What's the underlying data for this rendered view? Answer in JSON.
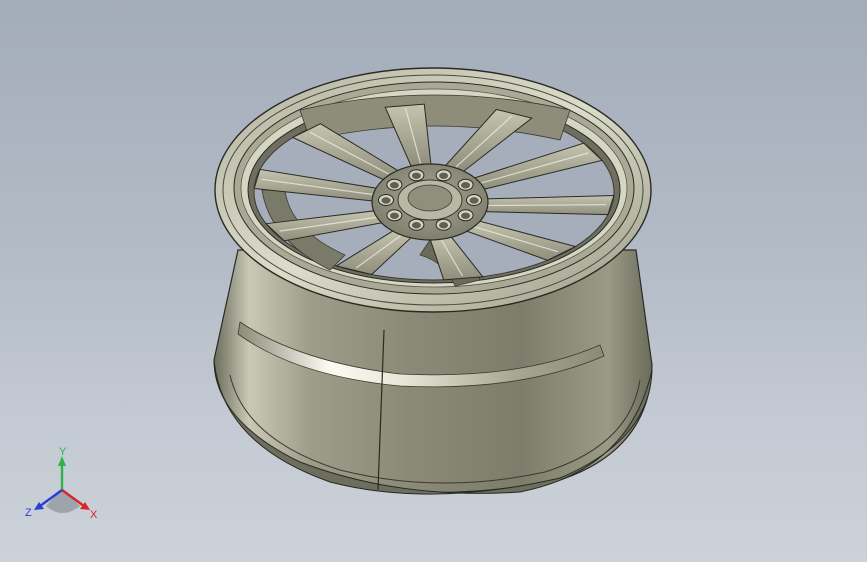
{
  "triad": {
    "x_label": "X",
    "y_label": "Y",
    "z_label": "Z",
    "x_color": "#d9242b",
    "y_color": "#2fb34a",
    "z_color": "#2a3fd6"
  },
  "model": {
    "icon": "alloy-wheel-model",
    "spoke_count": 10,
    "lug_hole_count": 10,
    "body_color": "#8f8f7d",
    "highlight_color": "#f4f4ea",
    "edge_color": "#2a2a24"
  }
}
